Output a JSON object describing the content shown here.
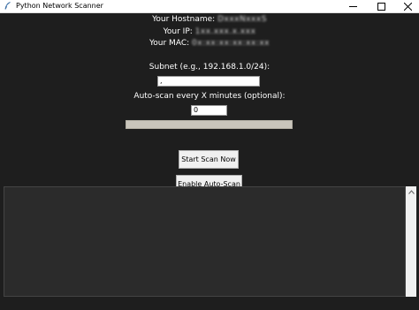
{
  "window": {
    "title": "Python Network Scanner",
    "icon": "feather-icon"
  },
  "info": {
    "hostname_label": "Your Hostname:",
    "hostname_value": "DxxxNxxxS",
    "ip_label": "Your IP:",
    "ip_value": "1xx.xxx.x.xxx",
    "mac_label": "Your MAC:",
    "mac_value": "0x:xx:xx:xx:xx:xx"
  },
  "form": {
    "subnet_label": "Subnet (e.g., 192.168.1.0/24):",
    "subnet_value": ",",
    "interval_label": "Auto-scan every X minutes (optional):",
    "interval_value": "0",
    "progress": 0
  },
  "buttons": {
    "start_scan": "Start Scan Now",
    "auto_scan": "Enable Auto-Scan"
  },
  "output": {
    "text": ""
  },
  "colors": {
    "background": "#1e1e1e",
    "text": "#ffffff",
    "progress_trough": "#c9c5bb",
    "button": "#f0f0f0"
  }
}
